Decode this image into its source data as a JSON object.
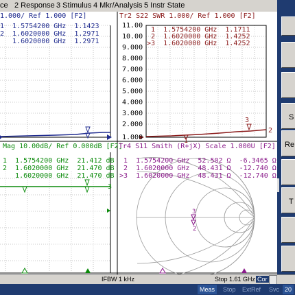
{
  "menu": {
    "items": [
      "ce",
      "2 Response",
      "3 Stimulus",
      "4 Mkr/Analysis",
      "5 Instr State"
    ]
  },
  "tr1": {
    "header": "1.000/ Ref 1.000 [F2]",
    "markers": [
      "1  1.5754200 GHz  1.1423",
      "2  1.6020000 GHz  1.2971",
      "   1.6020000 GHz  1.2971"
    ]
  },
  "tr2": {
    "header": "Tr2 S22 SWR 1.000/ Ref 1.000 [F2]",
    "markers": [
      " 1  1.5754200 GHz  1.1711",
      " 2  1.6020000 GHz  1.4252",
      ">3  1.6020000 GHz  1.4252"
    ],
    "yticks": [
      "11.00",
      "10.00",
      "9.000",
      "8.000",
      "7.000",
      "6.000",
      "5.000",
      "4.000",
      "3.000",
      "2.000",
      "1.000"
    ],
    "trace_tag_1": "1",
    "trace_tag_2": "2",
    "trace_tag_3": "3"
  },
  "tr3": {
    "header": "Mag 10.00dB/ Ref 0.000dB [F2]",
    "markers": [
      "1  1.5754200 GHz  21.412 dB",
      "2  1.6020000 GHz  21.470 dB",
      "   1.6020000 GHz  21.470 dB"
    ],
    "trace_tag": "3"
  },
  "tr4": {
    "header": "Tr4 S11 Smith (R+jX) Scale 1.000U [F2]",
    "markers": [
      " 1  1.5754200 GHz  52.502 Ω  -6.3465 Ω  1",
      " 2  1.6020000 GHz  48.431 Ω  -12.740 Ω  7",
      ">3  1.6020000 GHz  48.431 Ω  -12.740 Ω  7"
    ]
  },
  "status": {
    "ifbw": "IFBW 1 kHz",
    "stop": "Stop 1.61 GHz",
    "cor": "Cor"
  },
  "bottom": {
    "meas": "Meas",
    "stop": "Stop",
    "extref": "ExtRef",
    "svc": "Svc",
    "year": "20"
  },
  "side": {
    "labels": [
      "",
      "",
      "S",
      "Re",
      "",
      "",
      "T",
      "",
      ""
    ]
  },
  "colors": {
    "tr1": "#1f2b8f",
    "tr2": "#8b1a1a",
    "tr3": "#0a8a0a",
    "tr4": "#8a1a8a",
    "panel": "#1f3b70",
    "grid": "#bdbdbd"
  }
}
